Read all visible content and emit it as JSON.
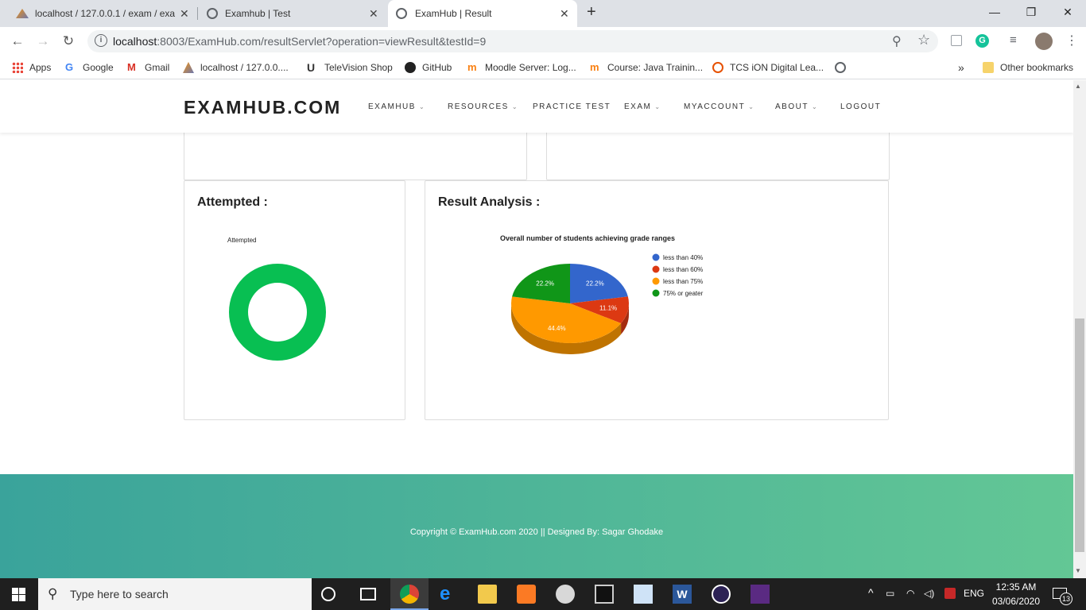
{
  "browser": {
    "tabs": [
      {
        "title": "localhost / 127.0.0.1 / exam / exa"
      },
      {
        "title": "Examhub | Test"
      },
      {
        "title": "ExamHub | Result"
      }
    ],
    "url_host": "localhost",
    "url_rest": ":8003/ExamHub.com/resultServlet?operation=viewResult&testId=9",
    "bookmarks": [
      "Apps",
      "Google",
      "Gmail",
      "localhost / 127.0.0....",
      "TeleVision Shop",
      "GitHub",
      "Moodle Server: Log...",
      "Course: Java Trainin...",
      "TCS iON Digital Lea..."
    ],
    "other_bookmarks": "Other bookmarks",
    "overflow": "»"
  },
  "site": {
    "brand": "EXAMHUB.COM",
    "nav": [
      {
        "label": "EXAMHUB",
        "dropdown": true
      },
      {
        "label": "RESOURCES",
        "dropdown": true
      },
      {
        "label": "PRACTICE TEST",
        "dropdown": false
      },
      {
        "label": "EXAM",
        "dropdown": true
      },
      {
        "label": "MYACCOUNT",
        "dropdown": true
      },
      {
        "label": "ABOUT",
        "dropdown": true
      },
      {
        "label": "LOGOUT",
        "dropdown": false
      }
    ],
    "attempted_card_title": "Attempted :",
    "analysis_card_title": "Result Analysis :",
    "footer": "Copyright © ExamHub.com 2020 || Designed By: Sagar Ghodake"
  },
  "chart_data": [
    {
      "type": "pie",
      "title": "Attempted",
      "donut": true,
      "legend": "none",
      "slices": [
        {
          "name": "Attempted",
          "value": 100,
          "color": "#08bf52"
        }
      ]
    },
    {
      "type": "pie",
      "title": "Overall number of students achieving grade ranges",
      "is3D": true,
      "legend": "right",
      "slices": [
        {
          "name": "less than 40%",
          "value": 22.2,
          "color": "#3366cc"
        },
        {
          "name": "less than 60%",
          "value": 11.1,
          "color": "#dc3912"
        },
        {
          "name": "less than 75%",
          "value": 44.4,
          "color": "#ff9900"
        },
        {
          "name": "75% or geater",
          "value": 22.2,
          "color": "#109618"
        }
      ]
    }
  ],
  "taskbar": {
    "search_placeholder": "Type here to search",
    "time": "12:35 AM",
    "date": "03/06/2020",
    "lang": "ENG",
    "notifications": "13"
  }
}
